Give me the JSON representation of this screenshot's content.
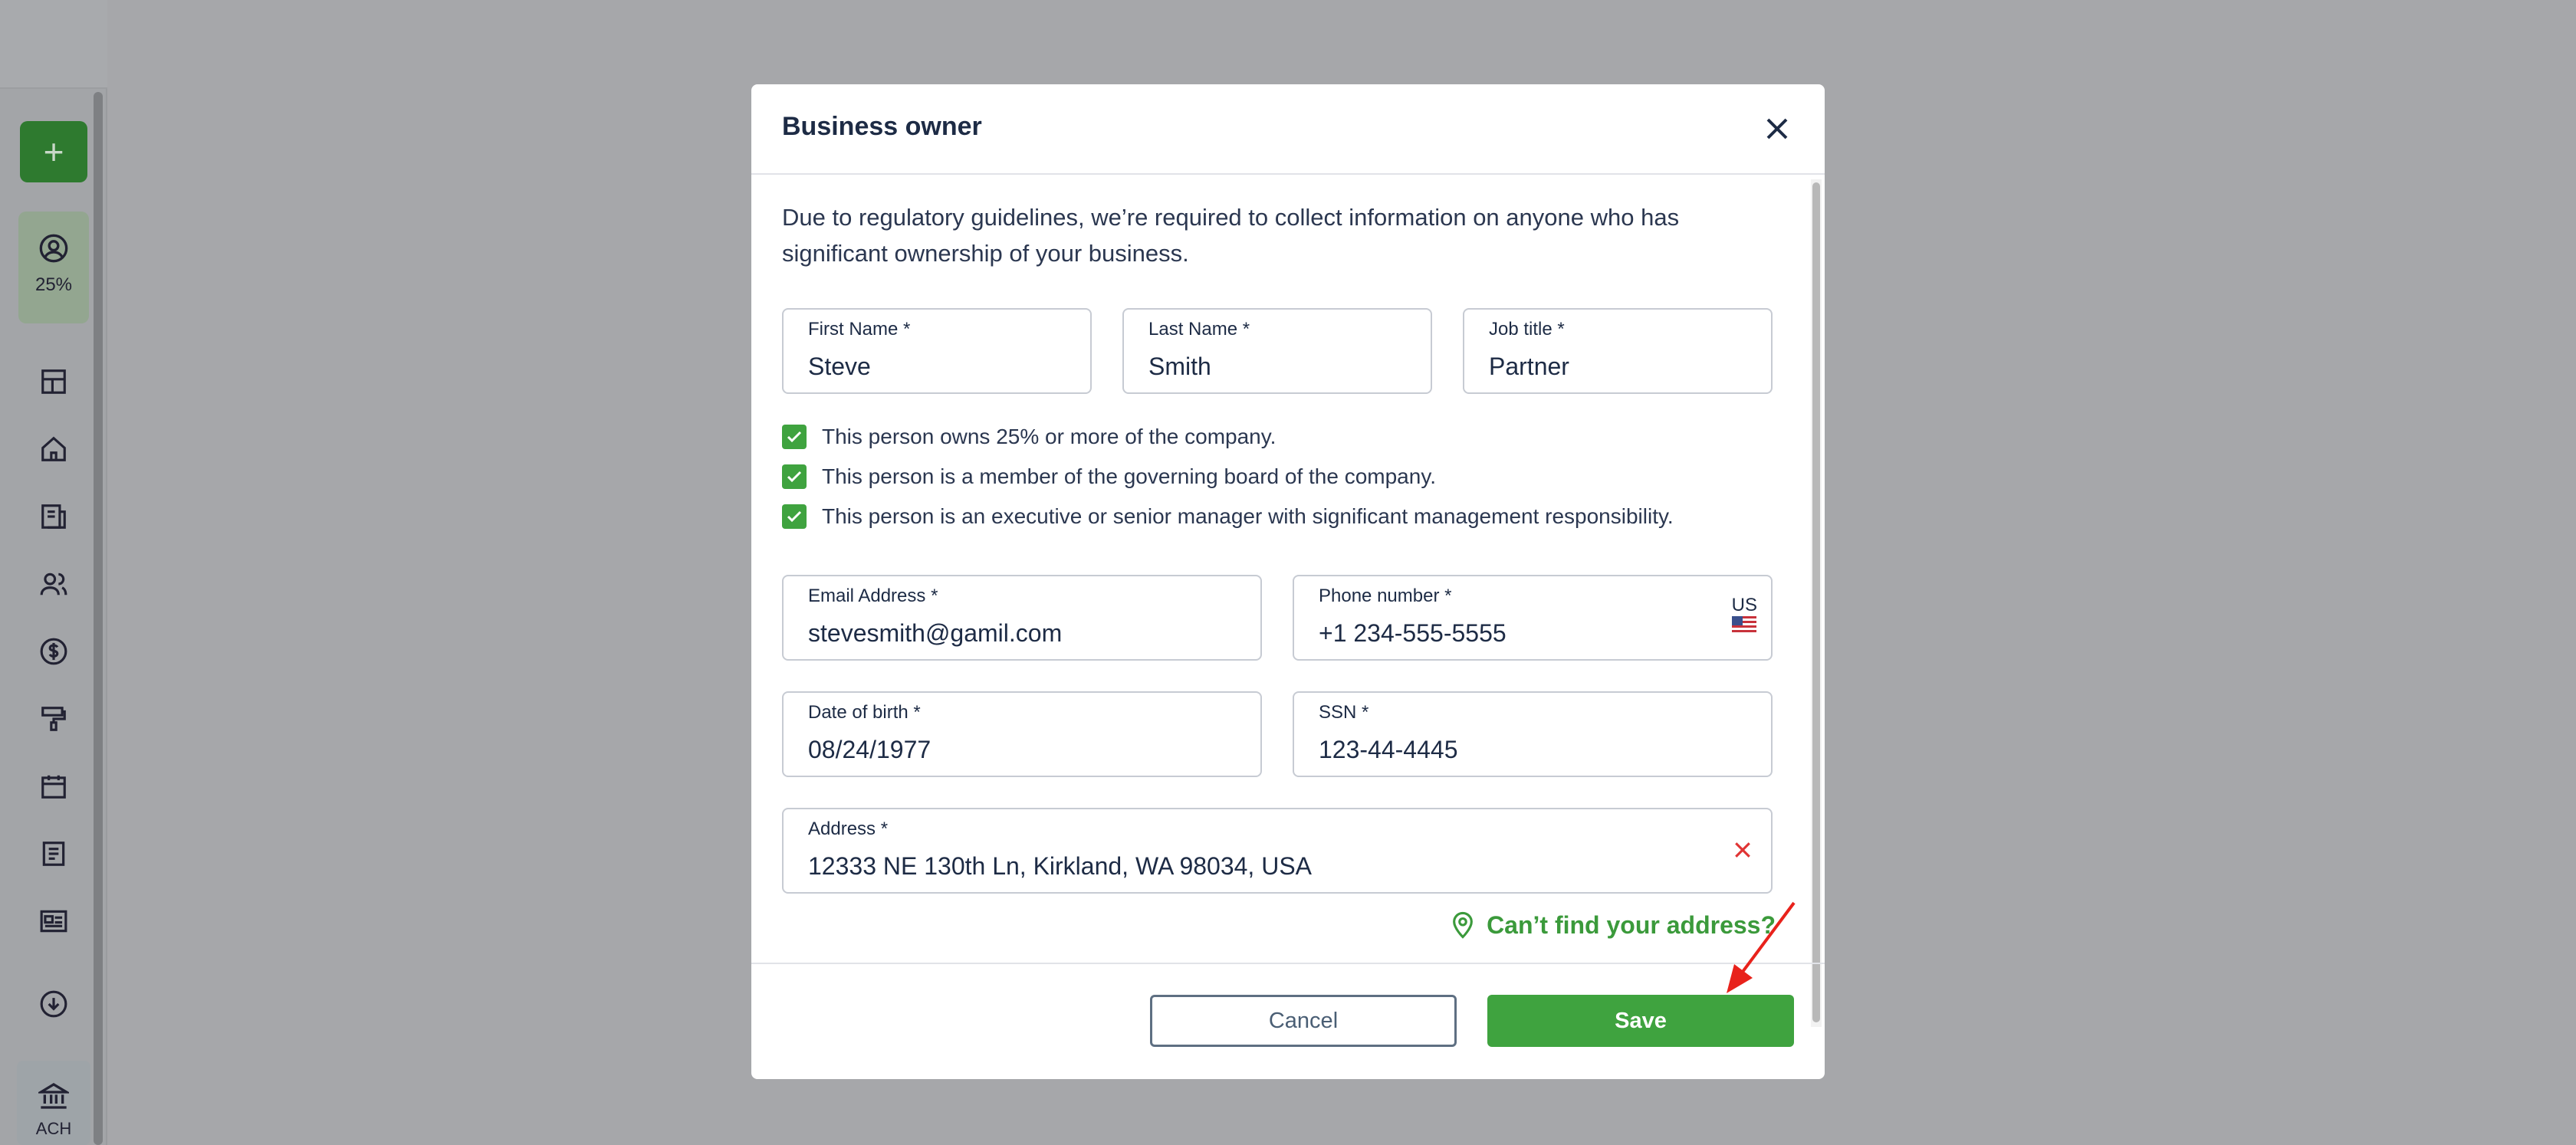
{
  "sidebar": {
    "add_label": "+",
    "setup_percent": "25%",
    "ach_label": "ACH"
  },
  "modal": {
    "title": "Business owner",
    "intro": "Due to regulatory guidelines, we’re required to collect information on anyone who has significant ownership of your business.",
    "first_name": {
      "label": "First Name *",
      "value": "Steve"
    },
    "last_name": {
      "label": "Last Name *",
      "value": "Smith"
    },
    "job_title": {
      "label": "Job title *",
      "value": "Partner"
    },
    "checkboxes": [
      {
        "label": "This person owns 25% or more of the company.",
        "checked": true
      },
      {
        "label": "This person is a member of the governing board of the company.",
        "checked": true
      },
      {
        "label": "This person is an executive or senior manager with significant management responsibility.",
        "checked": true
      }
    ],
    "email": {
      "label": "Email Address *",
      "value": "stevesmith@gamil.com"
    },
    "phone": {
      "label": "Phone number *",
      "value": "+1 234-555-5555",
      "country": "US"
    },
    "dob": {
      "label": "Date of birth *",
      "value": "08/24/1977"
    },
    "ssn": {
      "label": "SSN *",
      "value": "123-44-4445"
    },
    "address": {
      "label": "Address *",
      "value": "12333 NE 130th Ln, Kirkland, WA 98034, USA"
    },
    "find_address_link": "Can’t find your address?",
    "cancel_label": "Cancel",
    "save_label": "Save"
  },
  "colors": {
    "accent_green": "#3fa33f",
    "text_navy": "#1d2b45",
    "error_red": "#e03434",
    "annotation_red": "#e8221b"
  }
}
